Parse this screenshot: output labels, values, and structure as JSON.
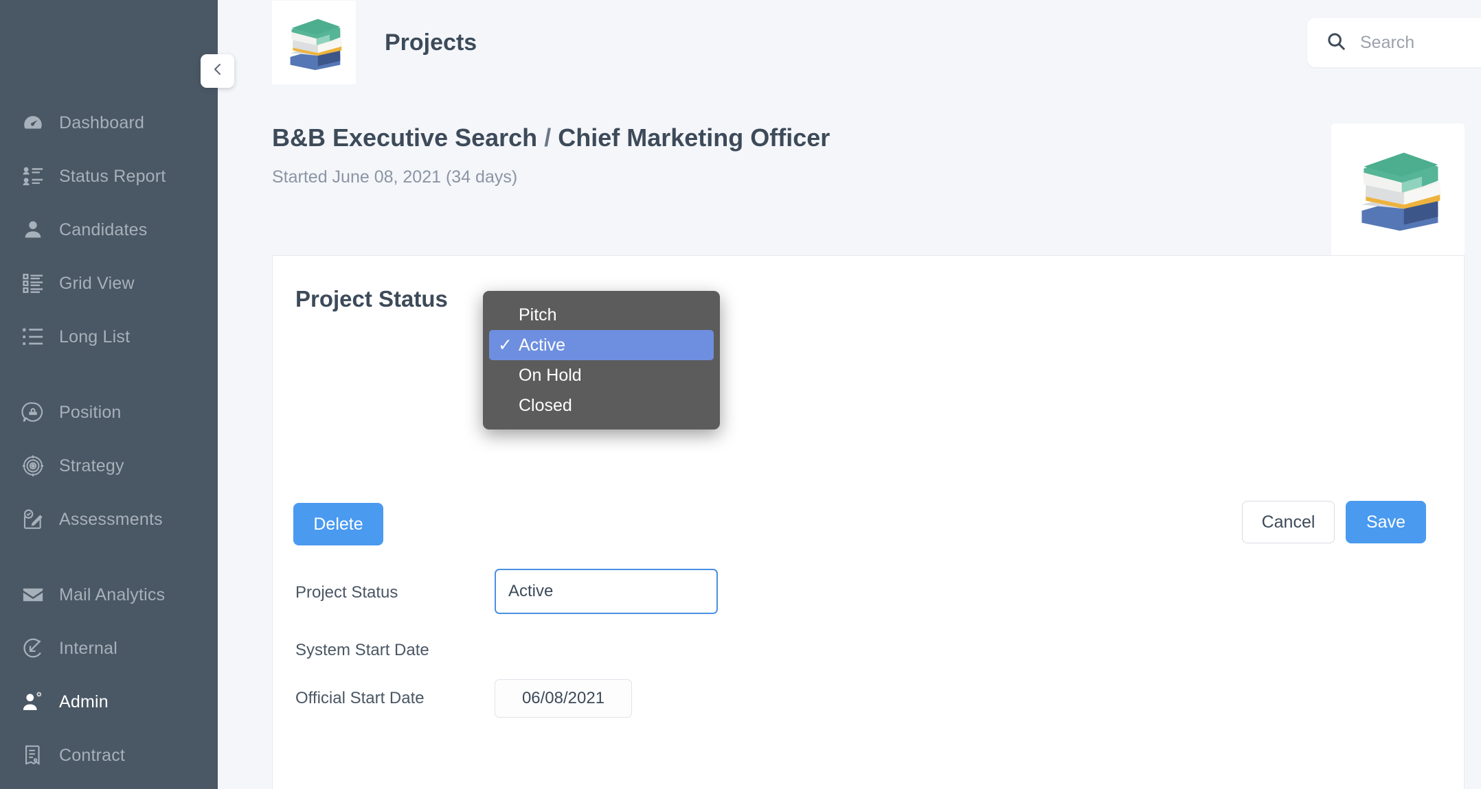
{
  "sidebar": {
    "collapse_icon": "chevron-left-icon",
    "groups": [
      {
        "items": [
          {
            "label": "Dashboard",
            "icon": "dashboard-gauge-icon",
            "active": false
          },
          {
            "label": "Status Report",
            "icon": "status-report-icon",
            "active": false
          },
          {
            "label": "Candidates",
            "icon": "person-icon",
            "active": false
          },
          {
            "label": "Grid View",
            "icon": "grid-list-icon",
            "active": false
          },
          {
            "label": "Long List",
            "icon": "bullet-list-icon",
            "active": false
          }
        ]
      },
      {
        "items": [
          {
            "label": "Position",
            "icon": "position-briefcase-icon",
            "active": false
          },
          {
            "label": "Strategy",
            "icon": "target-icon",
            "active": false
          },
          {
            "label": "Assessments",
            "icon": "assessment-pencil-icon",
            "active": false
          }
        ]
      },
      {
        "items": [
          {
            "label": "Mail Analytics",
            "icon": "envelope-icon",
            "active": false
          },
          {
            "label": "Internal",
            "icon": "internal-arrow-icon",
            "active": false
          },
          {
            "label": "Admin",
            "icon": "admin-user-gear-icon",
            "active": true
          },
          {
            "label": "Contract",
            "icon": "contract-document-icon",
            "active": false
          }
        ]
      }
    ]
  },
  "topbar": {
    "logo_icon": "stacked-books-icon",
    "title": "Projects",
    "search": {
      "icon": "search-icon",
      "placeholder": "Search",
      "value": ""
    }
  },
  "project_header": {
    "company": "B&B Executive Search",
    "separator": "/",
    "role": "Chief Marketing Officer",
    "started": "Started June 08, 2021 (34 days)",
    "thumbnail_icon": "stacked-books-icon"
  },
  "card": {
    "title": "Project Status",
    "fields": [
      {
        "label": "Project Status",
        "value": "Active",
        "type": "select"
      },
      {
        "label": "System Start Date",
        "value": "",
        "type": "text"
      },
      {
        "label": "Official Start Date",
        "value": "06/08/2021",
        "type": "date"
      }
    ],
    "buttons": {
      "delete": "Delete",
      "cancel": "Cancel",
      "save": "Save"
    }
  },
  "select_popup": {
    "check_glyph": "✓",
    "options": [
      {
        "label": "Pitch",
        "selected": false
      },
      {
        "label": "Active",
        "selected": true
      },
      {
        "label": "On Hold",
        "selected": false
      },
      {
        "label": "Closed",
        "selected": false
      }
    ]
  },
  "colors": {
    "sidebar_bg": "#4a5764",
    "page_bg": "#f4f6fa",
    "accent_blue": "#4a9af0",
    "focus_blue": "#4a90e2",
    "popup_bg": "#5c5c5c",
    "popup_highlight": "#6e8fe0",
    "text_dark": "#3d4a59",
    "text_muted": "#8b95a3"
  }
}
